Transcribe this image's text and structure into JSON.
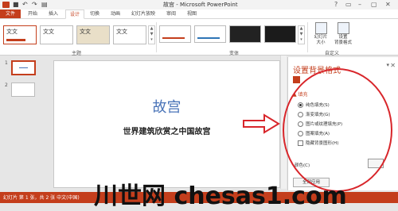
{
  "titlebar": {
    "title": "故宫 - Microsoft PowerPoint",
    "winbtns": [
      "?",
      "▭",
      "–",
      "▢",
      "✕"
    ]
  },
  "tabs": [
    "文件",
    "开始",
    "插入",
    "设计",
    "切换",
    "动画",
    "幻灯片放映",
    "审阅",
    "视图"
  ],
  "active_tab": "设计",
  "ribbon": {
    "themes": [
      "文文",
      "文文",
      "文文",
      "文文"
    ],
    "group_themes": "主题",
    "group_variants": "变体",
    "group_custom": "自定义",
    "btn_slide_size": "幻灯片\n大小",
    "btn_bg_format": "设置\n背景格式"
  },
  "thumbnails": {
    "numbers": [
      "1",
      "2"
    ]
  },
  "slide": {
    "title": "故宫",
    "subtitle": "世界建筑欣赏之中国故宫"
  },
  "pane": {
    "title": "设置背景格式",
    "section": "▲ 填充",
    "options": [
      {
        "label": "纯色填充(S)",
        "type": "radio",
        "selected": true
      },
      {
        "label": "渐变填充(G)",
        "type": "radio",
        "selected": false
      },
      {
        "label": "图片或纹理填充(P)",
        "type": "radio",
        "selected": false
      },
      {
        "label": "图案填充(A)",
        "type": "radio",
        "selected": false
      },
      {
        "label": "隐藏背景图形(H)",
        "type": "checkbox",
        "selected": false
      }
    ],
    "color_label": "颜色(C)",
    "apply_label": "全部应用"
  },
  "status": {
    "text": "幻灯片 第 1 张，共 2 张  中文(中国)"
  },
  "watermark": "川世网 chesas1.com",
  "colors": {
    "accent": "#c43e1c",
    "annotation": "#d8262b",
    "title_blue": "#4a74b8"
  }
}
